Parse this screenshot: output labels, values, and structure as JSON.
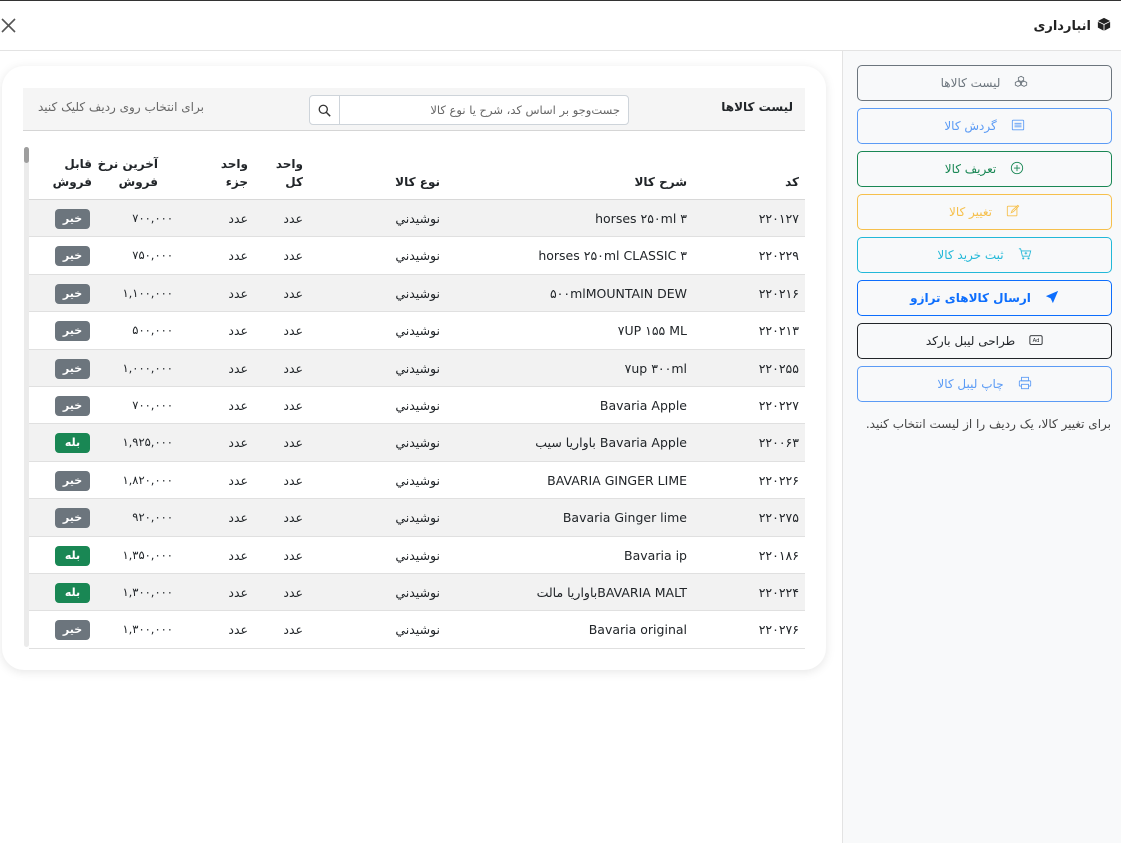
{
  "window": {
    "title": "انبارداری",
    "title_icon": "box-icon",
    "close_icon": "close-icon"
  },
  "sidebar": {
    "buttons": [
      {
        "label": "لیست کالاها",
        "icon": "boxes-icon",
        "color": "#6c757d"
      },
      {
        "label": "گردش کالا",
        "icon": "list-icon",
        "color": "#5b9bf5"
      },
      {
        "label": "تعریف کالا",
        "icon": "plus-circle-icon",
        "color": "#198754"
      },
      {
        "label": "تغییر کالا",
        "icon": "edit-icon",
        "color": "#f6c04c"
      },
      {
        "label": "ثبت خرید کالا",
        "icon": "cart-icon",
        "color": "#22b8d8"
      },
      {
        "label": "ارسال کالاهای ترازو",
        "icon": "send-icon",
        "color": "#0d6efd"
      },
      {
        "label": "طراحی لیبل بارکد",
        "icon": "ad-icon",
        "color": "#212529"
      },
      {
        "label": "چاپ لیبل کالا",
        "icon": "printer-icon",
        "color": "#5b9bf5"
      }
    ],
    "hint": "برای تغییر کالا، یک ردیف را از لیست انتخاب کنید."
  },
  "list": {
    "title": "لیست کالاها",
    "search_placeholder": "جست‌وجو بر اساس کد، شرح یا نوع کالا",
    "hint": "برای انتخاب روی ردیف کلیک کنید",
    "headers": {
      "code": "کد",
      "description": "شرح کالا",
      "type": "نوع کالا",
      "unit_whole_1": "واحد",
      "unit_whole_2": "کل",
      "unit_part_1": "واحد",
      "unit_part_2": "جزء",
      "last_price_1": "آخرین نرخ",
      "last_price_2": "فروش",
      "sellable_1": "قابل",
      "sellable_2": "فروش"
    },
    "rows": [
      {
        "code": "۲۲۰۱۲۷",
        "description": "horses ۲۵۰ml ۳",
        "type": "نوشيدني",
        "unit_whole": "عدد",
        "unit_part": "عدد",
        "last_price": "۷۰۰,۰۰۰",
        "sellable": "خیر",
        "sellable_flag": false
      },
      {
        "code": "۲۲۰۲۲۹",
        "description": "horses ۲۵۰ml CLASSIC ۳",
        "type": "نوشيدني",
        "unit_whole": "عدد",
        "unit_part": "عدد",
        "last_price": "۷۵۰,۰۰۰",
        "sellable": "خیر",
        "sellable_flag": false
      },
      {
        "code": "۲۲۰۲۱۶",
        "description": "۵۰۰mlMOUNTAIN DEW",
        "type": "نوشيدني",
        "unit_whole": "عدد",
        "unit_part": "عدد",
        "last_price": "۱,۱۰۰,۰۰۰",
        "sellable": "خیر",
        "sellable_flag": false
      },
      {
        "code": "۲۲۰۲۱۳",
        "description": "۷UP ۱۵۵ ML",
        "type": "نوشيدني",
        "unit_whole": "عدد",
        "unit_part": "عدد",
        "last_price": "۵۰۰,۰۰۰",
        "sellable": "خیر",
        "sellable_flag": false
      },
      {
        "code": "۲۲۰۲۵۵",
        "description": "۷up ۳۰۰ml",
        "type": "نوشيدني",
        "unit_whole": "عدد",
        "unit_part": "عدد",
        "last_price": "۱,۰۰۰,۰۰۰",
        "sellable": "خیر",
        "sellable_flag": false
      },
      {
        "code": "۲۲۰۲۲۷",
        "description": "Bavaria Apple",
        "type": "نوشيدني",
        "unit_whole": "عدد",
        "unit_part": "عدد",
        "last_price": "۷۰۰,۰۰۰",
        "sellable": "خیر",
        "sellable_flag": false
      },
      {
        "code": "۲۲۰۰۶۳",
        "description": "Bavaria Apple باواريا سيب",
        "type": "نوشيدني",
        "unit_whole": "عدد",
        "unit_part": "عدد",
        "last_price": "۱,۹۲۵,۰۰۰",
        "sellable": "بله",
        "sellable_flag": true
      },
      {
        "code": "۲۲۰۲۲۶",
        "description": "BAVARIA GINGER LIME",
        "type": "نوشيدني",
        "unit_whole": "عدد",
        "unit_part": "عدد",
        "last_price": "۱,۸۲۰,۰۰۰",
        "sellable": "خیر",
        "sellable_flag": false
      },
      {
        "code": "۲۲۰۲۷۵",
        "description": "Bavaria Ginger lime",
        "type": "نوشيدني",
        "unit_whole": "عدد",
        "unit_part": "عدد",
        "last_price": "۹۲۰,۰۰۰",
        "sellable": "خیر",
        "sellable_flag": false
      },
      {
        "code": "۲۲۰۱۸۶",
        "description": "Bavaria ip",
        "type": "نوشيدني",
        "unit_whole": "عدد",
        "unit_part": "عدد",
        "last_price": "۱,۳۵۰,۰۰۰",
        "sellable": "بله",
        "sellable_flag": true
      },
      {
        "code": "۲۲۰۲۲۴",
        "description": "BAVARIA MALTباواريا مالت",
        "type": "نوشيدني",
        "unit_whole": "عدد",
        "unit_part": "عدد",
        "last_price": "۱,۳۰۰,۰۰۰",
        "sellable": "بله",
        "sellable_flag": true
      },
      {
        "code": "۲۲۰۲۷۶",
        "description": "Bavaria original",
        "type": "نوشيدني",
        "unit_whole": "عدد",
        "unit_part": "عدد",
        "last_price": "۱,۳۰۰,۰۰۰",
        "sellable": "خیر",
        "sellable_flag": false
      }
    ]
  }
}
